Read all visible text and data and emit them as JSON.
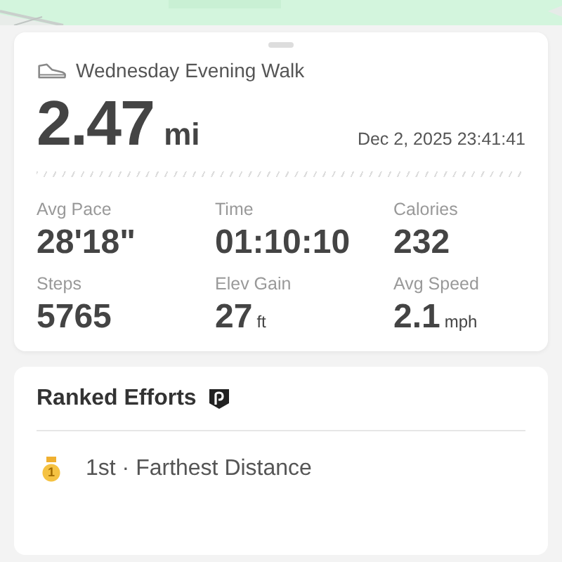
{
  "activity": {
    "title": "Wednesday Evening Walk",
    "distance": "2.47",
    "distance_unit": "mi",
    "datetime": "Dec 2, 2025 23:41:41",
    "stats": [
      {
        "label": "Avg Pace",
        "value": "28'18\""
      },
      {
        "label": "Time",
        "value": "01:10:10"
      },
      {
        "label": "Calories",
        "value": "232"
      },
      {
        "label": "Steps",
        "value": "5765"
      },
      {
        "label": "Elev Gain",
        "value": "27",
        "unit": "ft"
      },
      {
        "label": "Avg Speed",
        "value": "2.1",
        "unit": "mph"
      }
    ]
  },
  "ranked_efforts": {
    "title": "Ranked Efforts",
    "items": [
      {
        "rank": "1",
        "text": "1st · Farthest Distance"
      }
    ]
  }
}
